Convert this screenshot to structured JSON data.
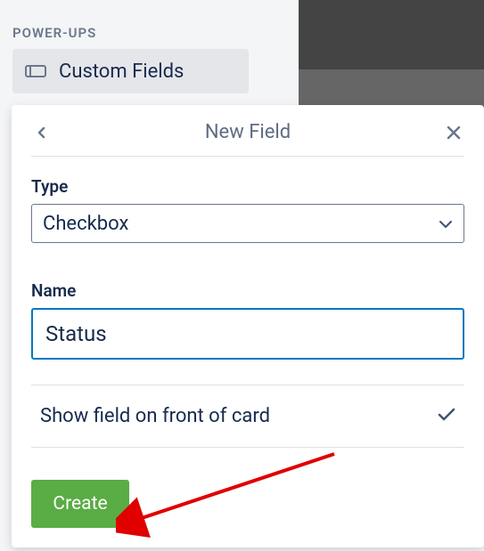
{
  "sidebar": {
    "section_label": "POWER-UPS",
    "custom_fields_label": "Custom Fields"
  },
  "dialog": {
    "title": "New Field",
    "type": {
      "label": "Type",
      "value": "Checkbox"
    },
    "name": {
      "label": "Name",
      "value": "Status"
    },
    "show_on_front": {
      "label": "Show field on front of card",
      "checked": true
    },
    "create_label": "Create"
  }
}
